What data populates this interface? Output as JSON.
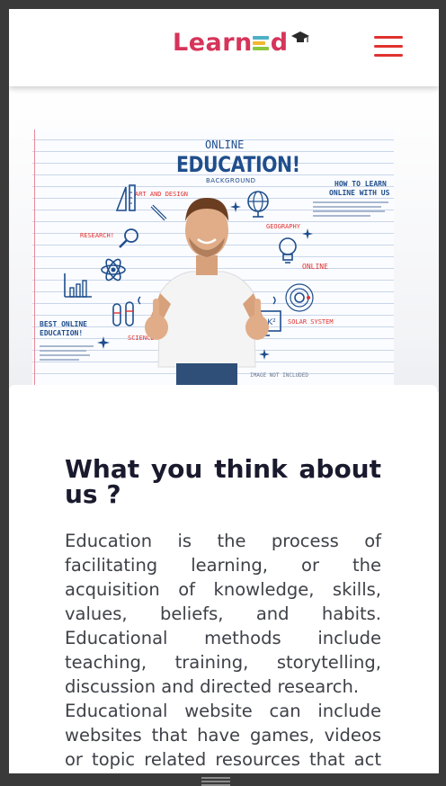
{
  "header": {
    "logo_text_a": "Learn",
    "logo_text_b": "d",
    "menu_icon": "hamburger-menu-icon"
  },
  "hero": {
    "image_title_top": "ONLINE",
    "image_title_main": "EDUCATION!",
    "image_title_sub": "BACKGROUND",
    "labels": {
      "art_design": "ART AND DESIGN",
      "research": "RESEARCH!",
      "best_online": "BEST ONLINE",
      "education": "EDUCATION!",
      "how_to": "HOW TO LEARN",
      "online_with_us": "ONLINE WITH US",
      "geography": "GEOGRAPHY",
      "online": "ONLINE",
      "solar_system": "SOLAR SYSTEM",
      "science": "SCIENCE",
      "image_note": "IMAGE NOT INCLUDED"
    }
  },
  "content": {
    "title": "What you think about us ?",
    "paragraph_1": "Education is the process of facilitating learning, or the acquisition of knowledge, skills, values, beliefs, and habits. Educational methods include teaching, training, storytelling, discussion and directed research.",
    "paragraph_2": "Educational website can include websites that have games, videos or topic related resources that act as tools to enhance learning and"
  },
  "colors": {
    "brand_red": "#e0322f",
    "logo_pink": "#d6345a",
    "title_dark": "#1a1a2e",
    "body_text": "#3f4148"
  }
}
